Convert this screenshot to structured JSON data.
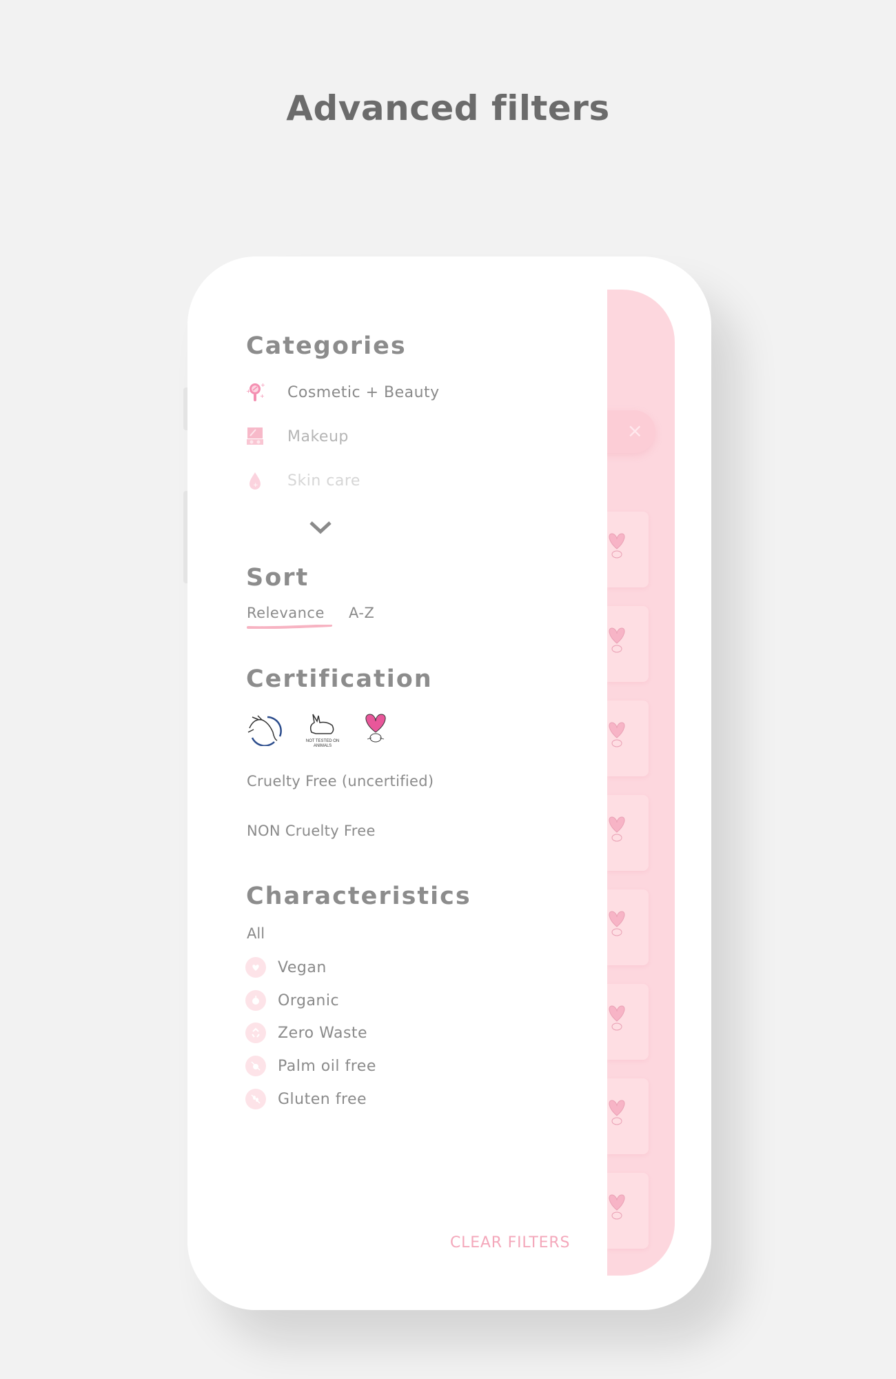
{
  "page": {
    "title": "Advanced filters"
  },
  "drawer": {
    "categories": {
      "heading": "Categories",
      "items": [
        {
          "label": "Cosmetic + Beauty",
          "icon": "mirror-icon"
        },
        {
          "label": "Makeup",
          "icon": "makeup-palette-icon"
        },
        {
          "label": "Skin care",
          "icon": "drop-icon"
        }
      ],
      "expand_icon": "chevron-down-icon"
    },
    "sort": {
      "heading": "Sort",
      "options": [
        {
          "label": "Relevance",
          "selected": true
        },
        {
          "label": "A-Z",
          "selected": false
        }
      ]
    },
    "certification": {
      "heading": "Certification",
      "logos": [
        {
          "name": "leaping-bunny-icon"
        },
        {
          "name": "not-tested-on-animals-icon",
          "text": "NOT TESTED ON ANIMALS"
        },
        {
          "name": "heart-bunny-icon"
        }
      ],
      "options": [
        "Cruelty Free (uncertified)",
        "NON Cruelty Free"
      ]
    },
    "characteristics": {
      "heading": "Characteristics",
      "all_label": "All",
      "items": [
        {
          "label": "Vegan",
          "icon": "vegan-heart-icon"
        },
        {
          "label": "Organic",
          "icon": "apple-icon"
        },
        {
          "label": "Zero Waste",
          "icon": "recycle-icon"
        },
        {
          "label": "Palm oil free",
          "icon": "palm-oil-free-icon"
        },
        {
          "label": "Gluten free",
          "icon": "gluten-free-icon"
        }
      ]
    },
    "clear_button": "CLEAR FILTERS"
  },
  "background": {
    "close_label": "×",
    "card_count": 8
  },
  "colors": {
    "accent_pink": "#f4a8bb",
    "panel_pink": "#fdd7de",
    "text_gray": "#8a8a8a",
    "heading_gray": "#8c8c8c",
    "page_bg": "#f2f2f2"
  }
}
